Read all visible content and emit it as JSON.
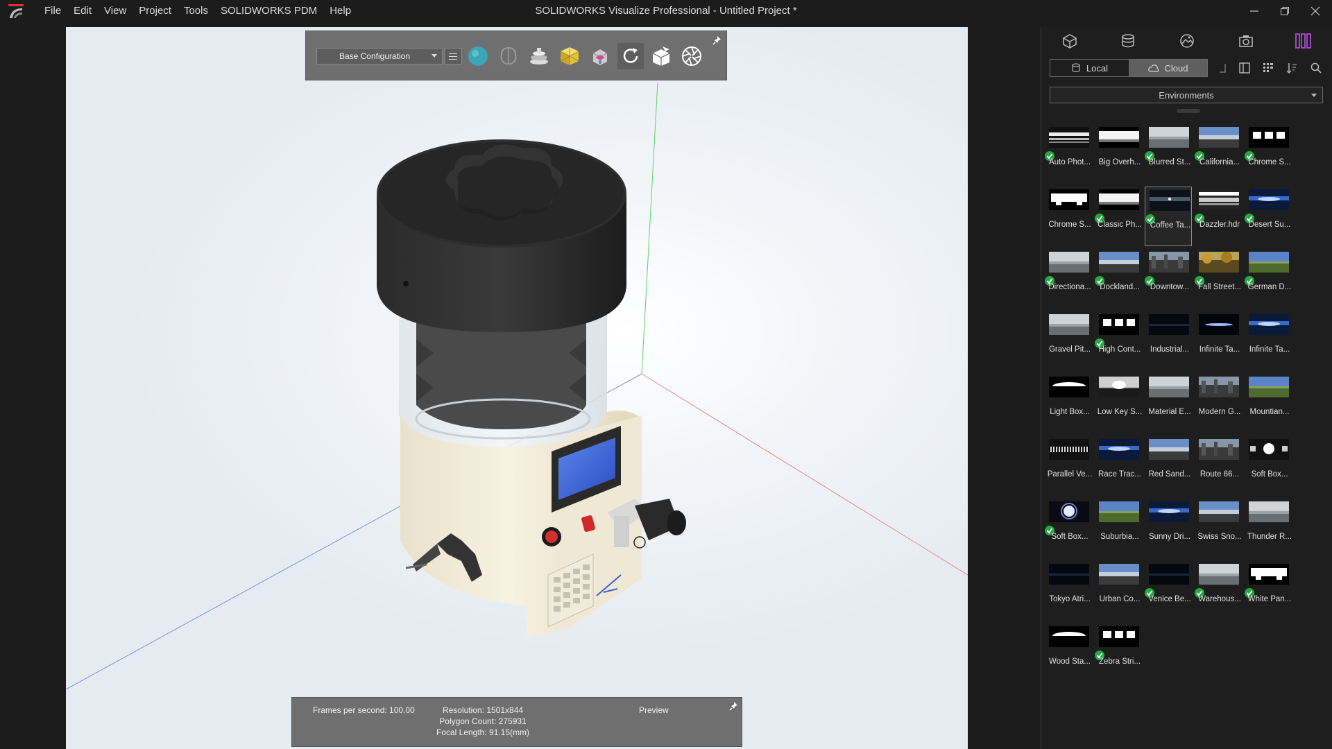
{
  "menu": {
    "items": [
      "File",
      "Edit",
      "View",
      "Project",
      "Tools",
      "SOLIDWORKS PDM",
      "Help"
    ]
  },
  "window": {
    "title": "SOLIDWORKS Visualize Professional - Untitled Project *"
  },
  "toolbar": {
    "configuration": "Base Configuration",
    "icons": [
      "sphere-icon",
      "brain-icon",
      "floor-stack-icon",
      "box-3d-icon",
      "paint-bucket-icon",
      "refresh-icon",
      "cube-split-icon",
      "aperture-icon"
    ]
  },
  "status": {
    "fps": "Frames per second: 100.00",
    "resolution": "Resolution: 1501x844",
    "polygons": "Polygon Count: 275931",
    "focal": "Focal Length: 91.15(mm)",
    "mode": "Preview"
  },
  "panel": {
    "tabs": [
      "models-tab-icon",
      "appearances-tab-icon",
      "scenes-tab-icon",
      "cameras-tab-icon",
      "libraries-tab-icon"
    ],
    "local_label": "Local",
    "cloud_label": "Cloud",
    "category": "Environments",
    "environments": [
      {
        "label": "Auto Phot...",
        "checked": true,
        "style": "bars"
      },
      {
        "label": "Big Overh...",
        "checked": false,
        "style": "dark-band"
      },
      {
        "label": "Blurred St...",
        "checked": true,
        "style": "grey-soft"
      },
      {
        "label": "California...",
        "checked": true,
        "style": "sky-blue"
      },
      {
        "label": "Chrome S...",
        "checked": true,
        "style": "dots"
      },
      {
        "label": "Chrome S...",
        "checked": false,
        "style": "blocks"
      },
      {
        "label": "Classic Ph...",
        "checked": true,
        "style": "dark-band"
      },
      {
        "label": "Coffee Ta...",
        "checked": true,
        "style": "dark-room",
        "selected": true
      },
      {
        "label": "Dazzler.hdr",
        "checked": true,
        "style": "stripes"
      },
      {
        "label": "Desert Su...",
        "checked": true,
        "style": "dusk"
      },
      {
        "label": "Directiona...",
        "checked": true,
        "style": "grey-soft"
      },
      {
        "label": "Dockland...",
        "checked": true,
        "style": "sky-blue"
      },
      {
        "label": "Downtow...",
        "checked": true,
        "style": "city"
      },
      {
        "label": "Fall Street...",
        "checked": true,
        "style": "autumn"
      },
      {
        "label": "German D...",
        "checked": true,
        "style": "field"
      },
      {
        "label": "Gravel Pit...",
        "checked": false,
        "style": "grey-soft"
      },
      {
        "label": "High Cont...",
        "checked": true,
        "style": "dots"
      },
      {
        "label": "Industrial...",
        "checked": false,
        "style": "night"
      },
      {
        "label": "Infinite Ta...",
        "checked": false,
        "style": "horizon-glow"
      },
      {
        "label": "Infinite Ta...",
        "checked": false,
        "style": "dusk"
      },
      {
        "label": "Light Box...",
        "checked": false,
        "style": "dome"
      },
      {
        "label": "Low Key S...",
        "checked": false,
        "style": "spot"
      },
      {
        "label": "Material E...",
        "checked": false,
        "style": "grey-soft"
      },
      {
        "label": "Modern G...",
        "checked": false,
        "style": "city"
      },
      {
        "label": "Mountian...",
        "checked": false,
        "style": "field"
      },
      {
        "label": "Parallel Ve...",
        "checked": false,
        "style": "stripes-v"
      },
      {
        "label": "Race Trac...",
        "checked": false,
        "style": "dusk"
      },
      {
        "label": "Red Sand...",
        "checked": false,
        "style": "sky-blue"
      },
      {
        "label": "Route 66...",
        "checked": false,
        "style": "city"
      },
      {
        "label": "Soft Box...",
        "checked": false,
        "style": "softbox"
      },
      {
        "label": "Soft Box...",
        "checked": true,
        "style": "softbox-blue"
      },
      {
        "label": "Suburbia...",
        "checked": false,
        "style": "field"
      },
      {
        "label": "Sunny Dri...",
        "checked": false,
        "style": "dusk"
      },
      {
        "label": "Swiss Sno...",
        "checked": false,
        "style": "sky-blue"
      },
      {
        "label": "Thunder R...",
        "checked": false,
        "style": "grey-soft"
      },
      {
        "label": "Tokyo Atri...",
        "checked": false,
        "style": "night"
      },
      {
        "label": "Urban Co...",
        "checked": false,
        "style": "sky-blue"
      },
      {
        "label": "Venice Be...",
        "checked": true,
        "style": "night"
      },
      {
        "label": "Warehous...",
        "checked": true,
        "style": "grey-soft"
      },
      {
        "label": "White Pan...",
        "checked": true,
        "style": "blocks"
      },
      {
        "label": "Wood Sta...",
        "checked": false,
        "style": "dome"
      },
      {
        "label": "Zebra Stri...",
        "checked": true,
        "style": "dots"
      }
    ]
  },
  "colors": {
    "accent_purple": "#b04ad8",
    "check_green": "#27a844",
    "toolbar_bg": "#6f6f6f",
    "panel_bg": "#1e1e1e"
  }
}
